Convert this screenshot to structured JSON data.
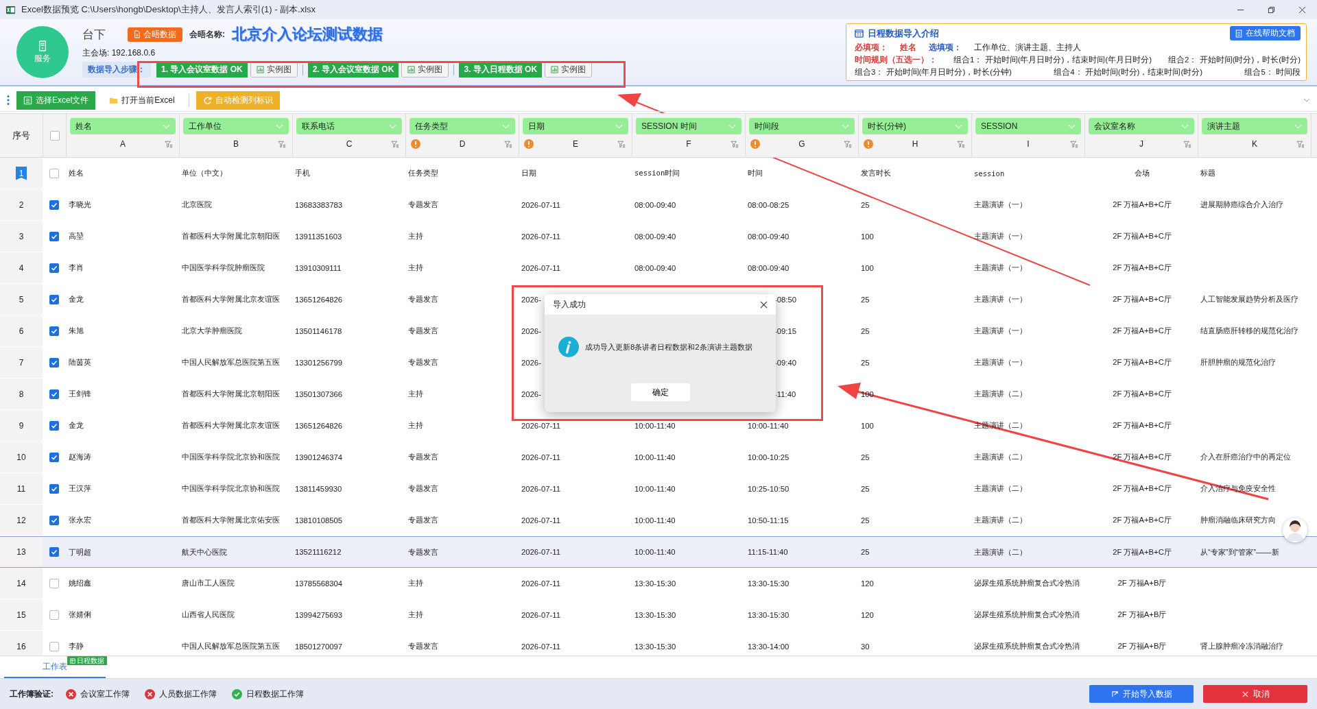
{
  "window": {
    "title": "Excel数据预览 C:\\Users\\hongb\\Desktop\\主持人、发言人索引(1) - 副本.xlsx"
  },
  "header": {
    "service_label": "服务",
    "venue": "台下",
    "tag": "会晤数据",
    "meeting_name_label": "会晤名称:",
    "meeting_name": "北京介入论坛测试数据",
    "main_venue": "主会场: 192.168.0.6",
    "steps_label": "数据导入步骤：",
    "steps": [
      {
        "label": "1. 导入会议室数据 OK",
        "example": "实例图"
      },
      {
        "label": "2. 导入会议室数据 OK",
        "example": "实例图"
      },
      {
        "label": "3. 导入日程数据 OK",
        "example": "实例图"
      }
    ]
  },
  "intro": {
    "title": "日程数据导入介绍",
    "help_button": "在线帮助文档",
    "lines": [
      [
        {
          "text": "必填项：",
          "kind": "required"
        },
        {
          "text": "姓名",
          "kind": "required"
        },
        {
          "text": "选填项：",
          "kind": "optional"
        },
        {
          "text": "工作单位、演讲主题、主持人",
          "kind": "plain"
        }
      ],
      [
        {
          "text": "时间规则（五选一）：",
          "kind": "required"
        },
        {
          "text": "组合1：  开始时间(年月日时分)，结束时间(年月日时分)",
          "kind": "plain"
        },
        {
          "text": "组合2：  开始时间(时分)，时长(时分)",
          "kind": "plain"
        }
      ],
      [
        {
          "text": "组合3：  开始时间(年月日时分)，时长(分钟)",
          "kind": "plain"
        },
        {
          "text": "组合4：  开始时间(时分)，结束时间(时分)",
          "kind": "plain"
        },
        {
          "text": "组合5：  时间段",
          "kind": "plain"
        }
      ]
    ]
  },
  "toolbar": {
    "buttons": [
      {
        "label": "选择Excel文件",
        "kind": "primary"
      },
      {
        "label": "打开当前Excel",
        "kind": "plain"
      },
      {
        "label": "自动检测列标识",
        "kind": "warning"
      }
    ]
  },
  "table": {
    "index_header": "序号",
    "select_all": false,
    "columns": [
      {
        "name": "姓名",
        "letter": "A",
        "warning": false
      },
      {
        "name": "工作单位",
        "letter": "B",
        "warning": false
      },
      {
        "name": "联系电话",
        "letter": "C",
        "warning": false
      },
      {
        "name": "任务类型",
        "letter": "D",
        "warning": true
      },
      {
        "name": "日期",
        "letter": "E",
        "warning": true
      },
      {
        "name": "SESSION 时间",
        "letter": "F",
        "warning": false
      },
      {
        "name": "时间段",
        "letter": "G",
        "warning": true
      },
      {
        "name": "时长(分钟)",
        "letter": "H",
        "warning": true
      },
      {
        "name": "SESSION",
        "letter": "I",
        "warning": false
      },
      {
        "name": "会议室名称",
        "letter": "J",
        "warning": false
      },
      {
        "name": "演讲主题",
        "letter": "K",
        "warning": false
      }
    ],
    "rows": [
      {
        "index": "1",
        "kind": "header",
        "checked": false,
        "selected": false,
        "cells": [
          "姓名",
          "单位（中文）",
          "手机",
          "任务类型",
          "日期",
          "session时间",
          "时间",
          "发言时长",
          "session",
          "会场",
          "标题"
        ]
      },
      {
        "index": "2",
        "kind": "data",
        "checked": true,
        "selected": false,
        "cells": [
          "李晓光",
          "北京医院",
          "13683383783",
          "专题发言",
          "2026-07-11",
          "08:00-09:40",
          "08:00-08:25",
          "25",
          "主题演讲（一）",
          "2F 万福A+B+C厅",
          "进展期肺癌综合介入治疗"
        ]
      },
      {
        "index": "3",
        "kind": "data",
        "checked": true,
        "selected": false,
        "cells": [
          "高堃",
          "首都医科大学附属北京朝阳医",
          "13911351603",
          "主持",
          "2026-07-11",
          "08:00-09:40",
          "08:00-09:40",
          "100",
          "主题演讲（一）",
          "2F 万福A+B+C厅",
          null
        ]
      },
      {
        "index": "4",
        "kind": "data",
        "checked": true,
        "selected": false,
        "cells": [
          "李肖",
          "中国医学科学院肿瘤医院",
          "13910309111",
          "主持",
          "2026-07-11",
          "08:00-09:40",
          "08:00-09:40",
          "100",
          "主题演讲（一）",
          "2F 万福A+B+C厅",
          null
        ]
      },
      {
        "index": "5",
        "kind": "data",
        "checked": true,
        "selected": false,
        "cells": [
          "金龙",
          "首都医科大学附属北京友谊医",
          "13651264826",
          "专题发言",
          "2026-",
          null,
          "-08:50",
          "25",
          "主题演讲（一）",
          "2F 万福A+B+C厅",
          "人工智能发展趋势分析及医疗"
        ]
      },
      {
        "index": "6",
        "kind": "data",
        "checked": true,
        "selected": false,
        "cells": [
          "朱旭",
          "北京大学肿瘤医院",
          "13501146178",
          "专题发言",
          "2026-",
          null,
          "-09:15",
          "25",
          "主题演讲（一）",
          "2F 万福A+B+C厅",
          "结直肠癌肝转移的规范化治疗"
        ]
      },
      {
        "index": "7",
        "kind": "data",
        "checked": true,
        "selected": false,
        "cells": [
          "陆茵英",
          "中国人民解放军总医院第五医",
          "13301256799",
          "专题发言",
          "2026-",
          null,
          "-09:40",
          "25",
          "主题演讲（一）",
          "2F 万福A+B+C厅",
          "肝胆肿瘤的规范化治疗"
        ]
      },
      {
        "index": "8",
        "kind": "data",
        "checked": true,
        "selected": false,
        "cells": [
          "王剑锋",
          "首都医科大学附属北京朝阳医",
          "13501307366",
          "主持",
          "2026-",
          null,
          "-11:40",
          "100",
          "主题演讲（二）",
          "2F 万福A+B+C厅",
          null
        ]
      },
      {
        "index": "9",
        "kind": "data",
        "checked": true,
        "selected": false,
        "cells": [
          "金龙",
          "首都医科大学附属北京友谊医",
          "13651264826",
          "主持",
          "2026-07-11",
          "10:00-11:40",
          "10:00-11:40",
          "100",
          "主题演讲（二）",
          "2F 万福A+B+C厅",
          null
        ]
      },
      {
        "index": "10",
        "kind": "data",
        "checked": true,
        "selected": false,
        "cells": [
          "赵海涛",
          "中国医学科学院北京协和医院",
          "13901246374",
          "专题发言",
          "2026-07-11",
          "10:00-11:40",
          "10:00-10:25",
          "25",
          "主题演讲（二）",
          "2F 万福A+B+C厅",
          "介入在肝癌治疗中的再定位"
        ]
      },
      {
        "index": "11",
        "kind": "data",
        "checked": true,
        "selected": false,
        "cells": [
          "王汉萍",
          "中国医学科学院北京协和医院",
          "13811459930",
          "专题发言",
          "2026-07-11",
          "10:00-11:40",
          "10:25-10:50",
          "25",
          "主题演讲（二）",
          "2F 万福A+B+C厅",
          "介入治疗与免疫安全性"
        ]
      },
      {
        "index": "12",
        "kind": "data",
        "checked": true,
        "selected": false,
        "cells": [
          "张永宏",
          "首都医科大学附属北京佑安医",
          "13810108505",
          "专题发言",
          "2026-07-11",
          "10:00-11:40",
          "10:50-11:15",
          "25",
          "主题演讲（二）",
          "2F 万福A+B+C厅",
          "肿瘤消融临床研究方向"
        ]
      },
      {
        "index": "13",
        "kind": "data",
        "checked": true,
        "selected": true,
        "cells": [
          "丁明超",
          "航天中心医院",
          "13521116212",
          "专题发言",
          "2026-07-11",
          "10:00-11:40",
          "11:15-11:40",
          "25",
          "主题演讲（二）",
          "2F 万福A+B+C厅",
          "从“专家”到“管家”——新"
        ]
      },
      {
        "index": "14",
        "kind": "data",
        "checked": false,
        "selected": false,
        "cells": [
          "姚绍鑫",
          "唐山市工人医院",
          "13785568304",
          "主持",
          "2026-07-11",
          "13:30-15:30",
          "13:30-15:30",
          "120",
          "泌尿生殖系统肿瘤复合式冷热消",
          "2F 万福A+B厅",
          null
        ]
      },
      {
        "index": "15",
        "kind": "data",
        "checked": false,
        "selected": false,
        "cells": [
          "张婧俐",
          "山西省人民医院",
          "13994275693",
          "主持",
          "2026-07-11",
          "13:30-15:30",
          "13:30-15:30",
          "120",
          "泌尿生殖系统肿瘤复合式冷热消",
          "2F 万福A+B厅",
          null
        ]
      },
      {
        "index": "16",
        "kind": "data",
        "checked": false,
        "selected": false,
        "cells": [
          "李静",
          "中国人民解放军总医院第五医",
          "18501270097",
          "专题发言",
          "2026-07-11",
          "13:30-15:30",
          "13:30-14:00",
          "30",
          "泌尿生殖系统肿瘤复合式冷热消",
          "2F 万福A+B厅",
          "肾上腺肿瘤冷冻消融治疗"
        ]
      }
    ]
  },
  "sheet_tag": "日程数据",
  "sheets": [
    {
      "label": "工作表",
      "selected": true
    }
  ],
  "validation": {
    "label": "工作簿验证:",
    "items": [
      {
        "label": "会议室工作簿",
        "valid": false
      },
      {
        "label": "人员数据工作簿",
        "valid": false
      },
      {
        "label": "日程数据工作簿",
        "valid": true
      }
    ]
  },
  "actions": [
    {
      "label": "开始导入数据",
      "kind": "primary"
    },
    {
      "label": "取消",
      "kind": "danger"
    }
  ],
  "dialog": {
    "title": "导入成功",
    "message": "成功导入更新8条讲者日程数据和2条演讲主题数据",
    "button": "确定"
  }
}
